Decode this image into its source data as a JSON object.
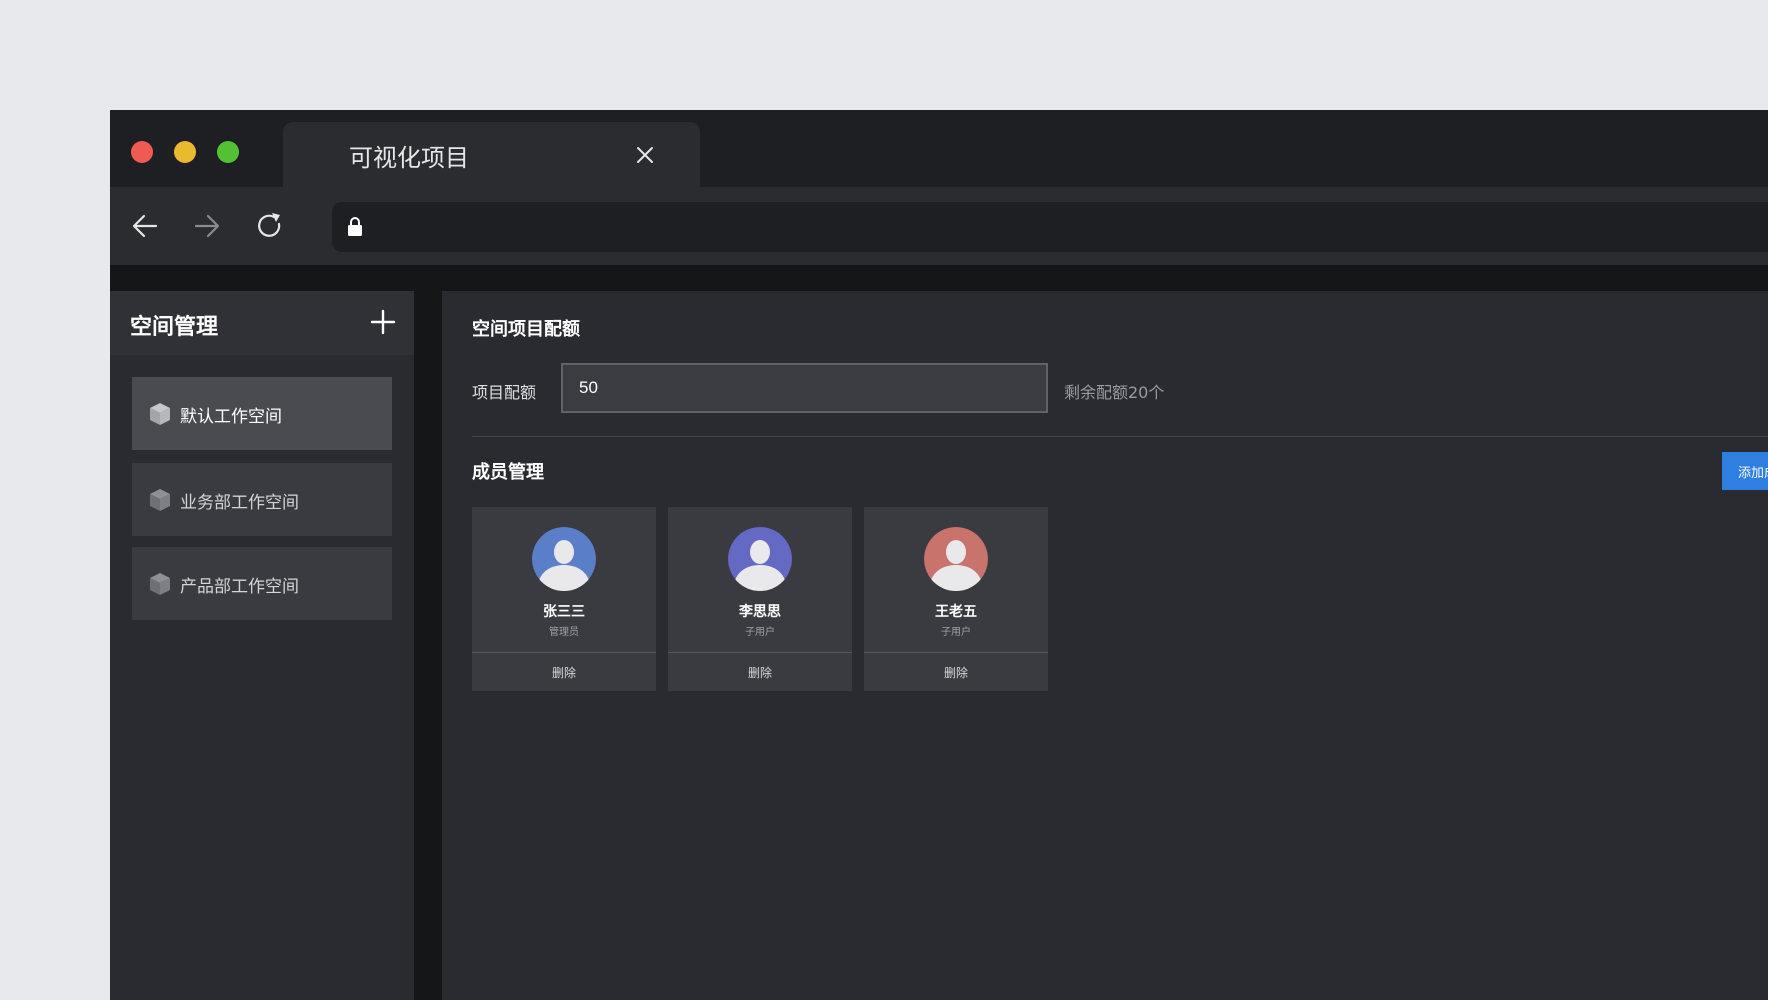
{
  "browser": {
    "tab_title": "可视化项目",
    "url": ""
  },
  "sidebar": {
    "title": "空间管理",
    "items": [
      {
        "label": "默认工作空间",
        "active": true
      },
      {
        "label": "业务部工作空间",
        "active": false
      },
      {
        "label": "产品部工作空间",
        "active": false
      }
    ]
  },
  "quota": {
    "section_title": "空间项目配额",
    "label": "项目配额",
    "value": "50",
    "remaining": "剩余配额20个"
  },
  "members": {
    "section_title": "成员管理",
    "add_button_label": "添加成员",
    "list": [
      {
        "name": "张三三",
        "role": "管理员",
        "delete_label": "删除",
        "avatar_color": "#5a7fc8"
      },
      {
        "name": "李思思",
        "role": "子用户",
        "delete_label": "删除",
        "avatar_color": "#6469c4"
      },
      {
        "name": "王老五",
        "role": "子用户",
        "delete_label": "删除",
        "avatar_color": "#c9736d"
      }
    ]
  },
  "colors": {
    "accent": "#2f7fe0",
    "window_bg": "#2a2b30"
  }
}
